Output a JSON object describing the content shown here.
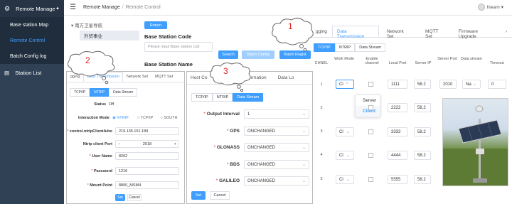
{
  "sidebar": {
    "group_label": "Remote Manage",
    "items": [
      {
        "label": "Base station Map",
        "active": false
      },
      {
        "label": "Remote Control",
        "active": true
      },
      {
        "label": "Batch Config log",
        "active": false
      }
    ],
    "station_list_label": "Station List"
  },
  "header": {
    "breadcrumb_root": "Remote Manage",
    "breadcrumb_current": "Remote Control",
    "user_name": "hiearn"
  },
  "tree": {
    "root": "南方卫星导航",
    "child": "外贸事业"
  },
  "main": {
    "return_label": "Return",
    "base_code_label": "Base Station Code",
    "base_code_placeholder": "Please input Base station cod",
    "search_label": "Search",
    "batch_config_label": "Batch Config",
    "batch_regist_label": "Batch Regist",
    "base_name_label": "Base Station Name"
  },
  "right_panel": {
    "tabs": [
      "gging",
      "Data Transmission",
      "Network Set",
      "MQTT Set",
      "Firmware Upgrade"
    ],
    "active_tab": "Data Transmission",
    "subtabs": [
      "TCP/IP",
      "NTRIP",
      "Data Stream"
    ],
    "active_subtab": "TCP/IP",
    "columns": [
      "CHNEL",
      "Work Mode",
      "Enable channel",
      "Local Port",
      "Server IP",
      "Server Port",
      "Data stream",
      "Timeout"
    ],
    "rows": [
      {
        "ch": "1",
        "mode": "Cl",
        "port": "1111",
        "ip": "58.2",
        "sport": "2010",
        "ds": "Na",
        "to": "0"
      },
      {
        "ch": "2",
        "mode": "",
        "port": "2222",
        "ip": "58.2",
        "sport": "",
        "ds": "",
        "to": ""
      },
      {
        "ch": "3",
        "mode": "Cl",
        "port": "3333",
        "ip": "58.2",
        "sport": "",
        "ds": "",
        "to": ""
      },
      {
        "ch": "4",
        "mode": "Cl",
        "port": "4444",
        "ip": "58.2",
        "sport": "",
        "ds": "",
        "to": ""
      },
      {
        "ch": "5",
        "mode": "Cl",
        "port": "5555",
        "ip": "58.2",
        "sport": "",
        "ds": "",
        "to": ""
      }
    ],
    "dropdown_options": [
      "Server",
      "Client"
    ],
    "dropdown_selected": "Client"
  },
  "panel2": {
    "tabs": [
      "gging",
      "Data Transmission",
      "Network Set",
      "MQTT Set"
    ],
    "subtabs": [
      "TCP/IP",
      "NTRIP",
      "Data Stream"
    ],
    "active_subtab": "NTRIP",
    "status_label": "Status",
    "status_value": "Off",
    "interaction_label": "Interaction Mode",
    "modes": [
      "NTRIP",
      "TCP/IP",
      "SOUTH"
    ],
    "client_addr_label": "control.ntripClientAdre",
    "client_addr_value": "219.135.151.189",
    "client_port_label": "Ntrip client Port",
    "client_port_value": "2018",
    "user_label": "User Name",
    "user_value": "8262",
    "pwd_label": "Password",
    "pwd_value": "1216",
    "mount_label": "Mount Point",
    "mount_value": "8800_MSM4",
    "set_label": "Set",
    "cancel_label": "Cancel"
  },
  "panel3": {
    "tabs": [
      "Host Co",
      "Satellite information",
      "Data Lo"
    ],
    "subtabs": [
      "TCP/IP",
      "NTRIP",
      "Data Stream"
    ],
    "active_subtab": "Data Stream",
    "fields": [
      {
        "label": "Output Interval",
        "value": "1"
      },
      {
        "label": "GPS",
        "value": "ONCHANGED"
      },
      {
        "label": "GLONASS",
        "value": "ONCHANGED"
      },
      {
        "label": "BDS",
        "value": "ONCHANGED"
      },
      {
        "label": "GALILEO",
        "value": "ONCHANGED"
      }
    ],
    "set_label": "Set",
    "cancel_label": "Cancel"
  },
  "callouts": [
    "1",
    "2",
    "3"
  ]
}
